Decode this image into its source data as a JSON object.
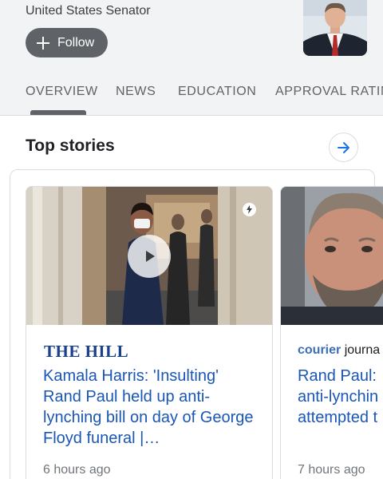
{
  "header": {
    "subtitle": "United States Senator",
    "follow_label": "Follow"
  },
  "tabs": [
    {
      "label": "OVERVIEW",
      "active": true
    },
    {
      "label": "NEWS",
      "active": false
    },
    {
      "label": "EDUCATION",
      "active": false
    },
    {
      "label": "APPROVAL RATIN",
      "active": false
    }
  ],
  "top_stories": {
    "title": "Top stories",
    "cards": [
      {
        "publisher": "THE HILL",
        "headline": "Kamala Harris: 'Insulting' Rand Paul held up anti-lynching bill on day of George Floyd funeral |…",
        "time": "6 hours ago"
      },
      {
        "publisher_part1": "courier",
        "publisher_part2": "journa",
        "headline": "Rand Paul:\nanti-lynchin\nattempted t",
        "time": "7 hours ago"
      }
    ]
  },
  "colors": {
    "header_bg": "#f1f3f4",
    "follow_bg": "#5f6368",
    "link_blue": "#1a56b5",
    "hill_blue": "#1a3f8b",
    "accent_arrow": "#1a73e8"
  },
  "icons": {
    "follow": "plus-icon",
    "more": "arrow-right-icon",
    "play": "play-icon",
    "amp": "lightning-icon"
  }
}
